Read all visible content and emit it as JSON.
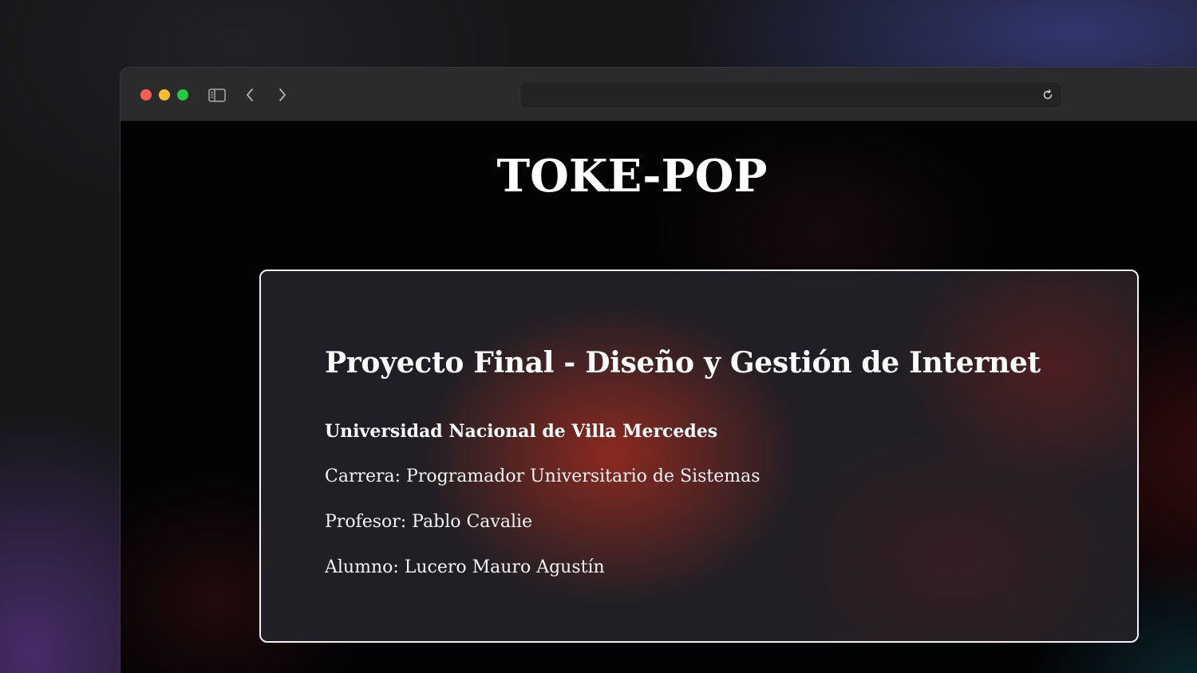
{
  "browser": {
    "url": "",
    "icons": {
      "sidebar": "sidebar-icon",
      "back": "chevron-left-icon",
      "forward": "chevron-right-icon",
      "reload": "reload-icon"
    }
  },
  "page": {
    "title": "TOKE-POP",
    "card": {
      "heading": "Proyecto Final - Diseño y Gestión de Internet",
      "university": "Universidad Nacional de Villa Mercedes",
      "career": "Carrera: Programador Universitario de Sistemas",
      "professor": "Profesor: Pablo Cavalie",
      "student": "Alumno: Lucero Mauro Agustín"
    }
  },
  "colors": {
    "close": "#ff5f57",
    "minimize": "#febc2e",
    "maximize": "#28c840",
    "card_border": "#f2f2f2"
  }
}
